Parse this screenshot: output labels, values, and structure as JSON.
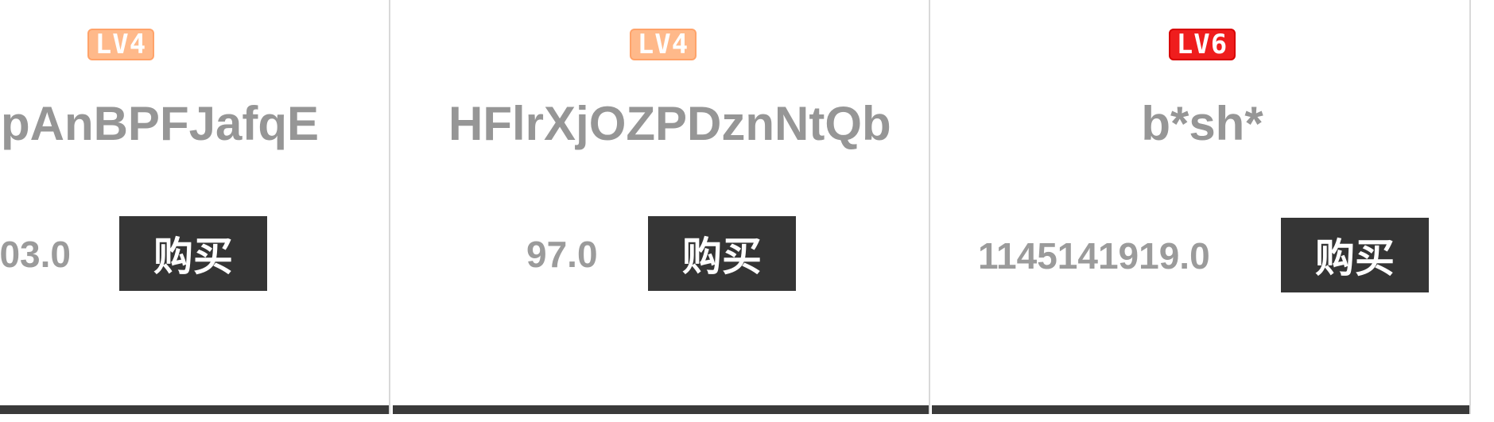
{
  "cards": [
    {
      "level": "LV4",
      "username": "VcpAnBPFJafqE",
      "price": "03.0",
      "buy_label": "购买"
    },
    {
      "level": "LV4",
      "username": "HFlrXjOZPDznNtQb",
      "price": "97.0",
      "buy_label": "购买"
    },
    {
      "level": "LV6",
      "username": "b*sh*",
      "price": "1145141919.0",
      "buy_label": "购买"
    }
  ],
  "colors": {
    "lv4_badge": "#ffb98a",
    "lv6_badge": "#ef1d1d",
    "button_bg": "#353535",
    "text_gray": "#969696",
    "card_bar": "#3a3a3a"
  }
}
